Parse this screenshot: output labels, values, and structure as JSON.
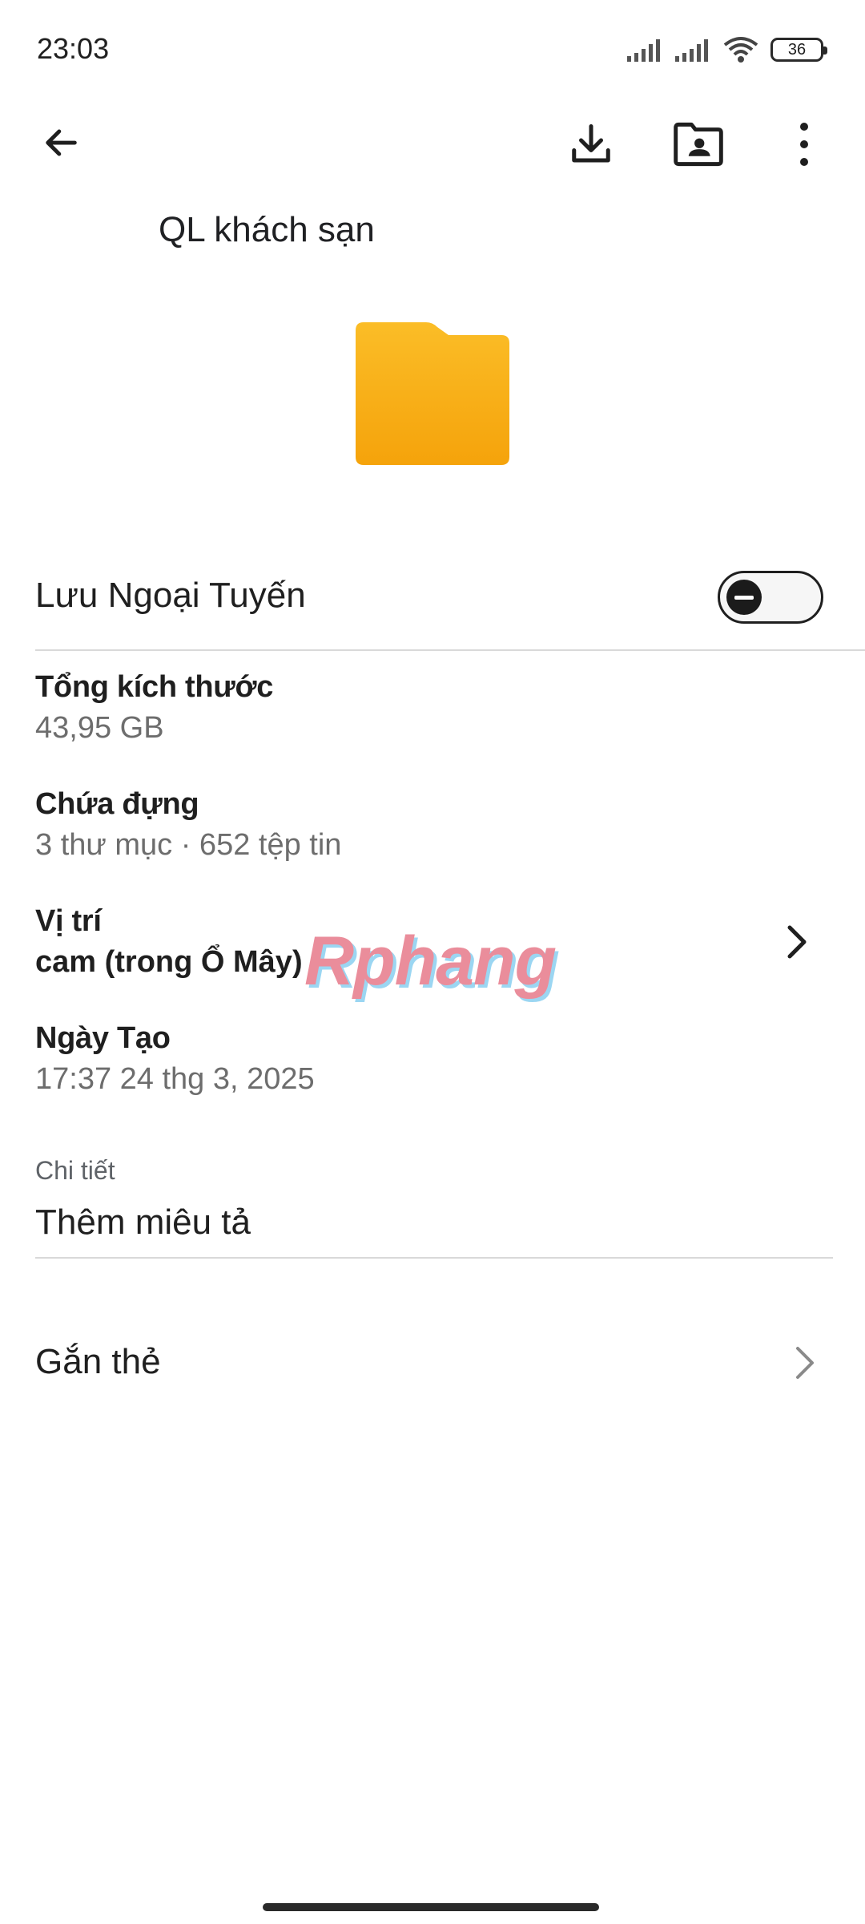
{
  "status_bar": {
    "time": "23:03",
    "battery": "36",
    "icons": [
      "signal-icon",
      "signal-icon",
      "wifi-icon",
      "battery-icon"
    ]
  },
  "toolbar": {
    "icons": [
      "back-arrow-icon",
      "download-icon",
      "shared-folder-icon",
      "more-vert-icon"
    ]
  },
  "folder": {
    "title": "QL khách sạn",
    "color": "#f9b31a"
  },
  "offline": {
    "label": "Lưu Ngoại Tuyến",
    "enabled": false
  },
  "info": {
    "size_label": "Tổng kích thước",
    "size_value": "43,95 GB",
    "contains_label": "Chứa đựng",
    "contains_value": "3 thư mục · 652 tệp tin",
    "location_label": "Vị trí",
    "location_value": "cam (trong Ổ Mây)",
    "created_label": "Ngày Tạo",
    "created_value": "17:37 24 thg 3, 2025"
  },
  "details": {
    "caption": "Chi tiết",
    "placeholder": "Thêm miêu tả"
  },
  "tags": {
    "label": "Gắn thẻ"
  },
  "watermark": "Rphang"
}
